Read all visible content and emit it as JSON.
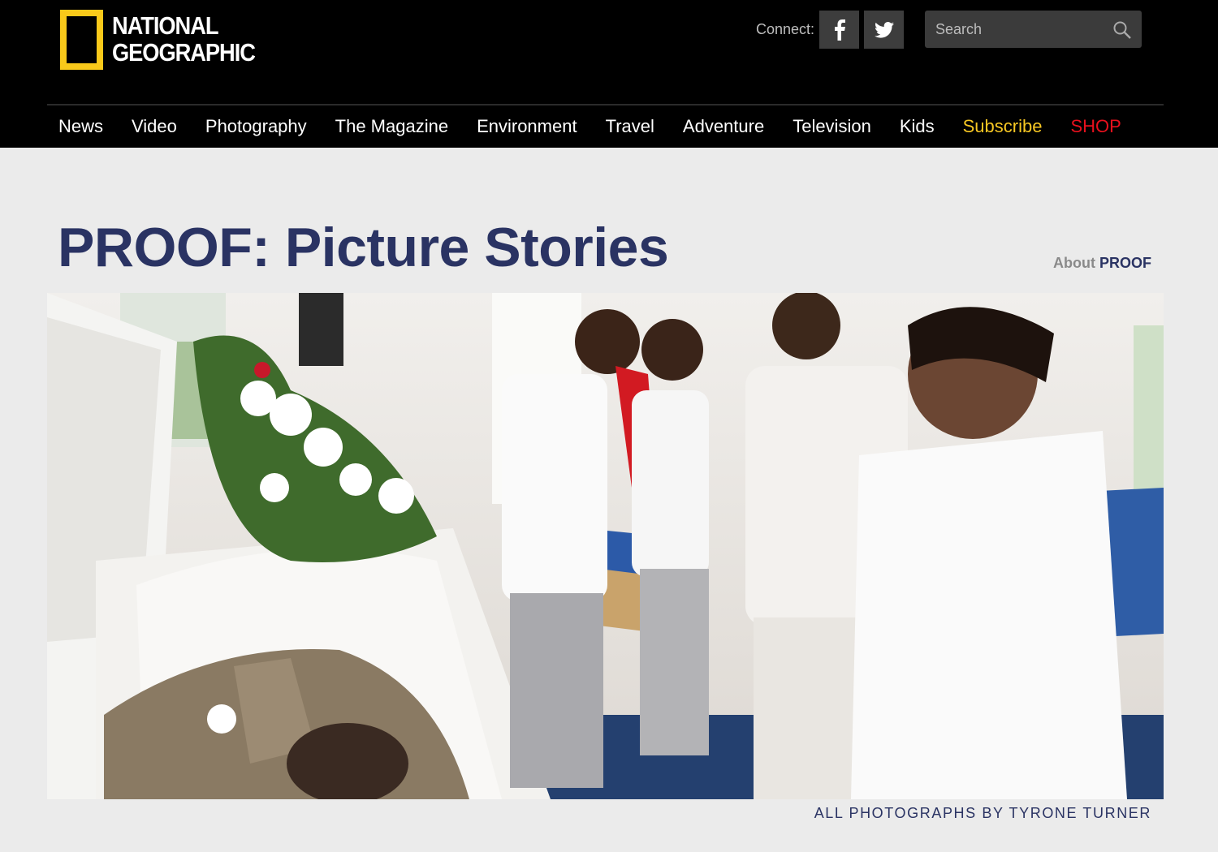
{
  "header": {
    "logo": {
      "line1": "NATIONAL",
      "line2": "GEOGRAPHIC",
      "border_color": "#f9c91a"
    },
    "connect_label": "Connect:",
    "social": [
      {
        "name": "facebook-icon",
        "glyph": "f"
      },
      {
        "name": "twitter-icon",
        "glyph": "bird"
      }
    ],
    "search": {
      "placeholder": "Search",
      "value": ""
    }
  },
  "nav": {
    "items": [
      {
        "label": "News"
      },
      {
        "label": "Video"
      },
      {
        "label": "Photography"
      },
      {
        "label": "The Magazine"
      },
      {
        "label": "Environment"
      },
      {
        "label": "Travel"
      },
      {
        "label": "Adventure"
      },
      {
        "label": "Television"
      },
      {
        "label": "Kids"
      },
      {
        "label": "Subscribe",
        "color": "#f7c723"
      },
      {
        "label": "SHOP",
        "color": "#e8101d"
      }
    ]
  },
  "main": {
    "title": "PROOF: Picture Stories",
    "about": {
      "pre": "About",
      "brand": "PROOF"
    },
    "hero_image": {
      "subject": "funeral-viewing-photo"
    },
    "credit": "ALL PHOTOGRAPHS BY TYRONE TURNER"
  },
  "colors": {
    "header_bg": "#000000",
    "page_bg": "#ebebeb",
    "title": "#2a3363",
    "subscribe": "#f7c723",
    "shop": "#e8101d"
  }
}
